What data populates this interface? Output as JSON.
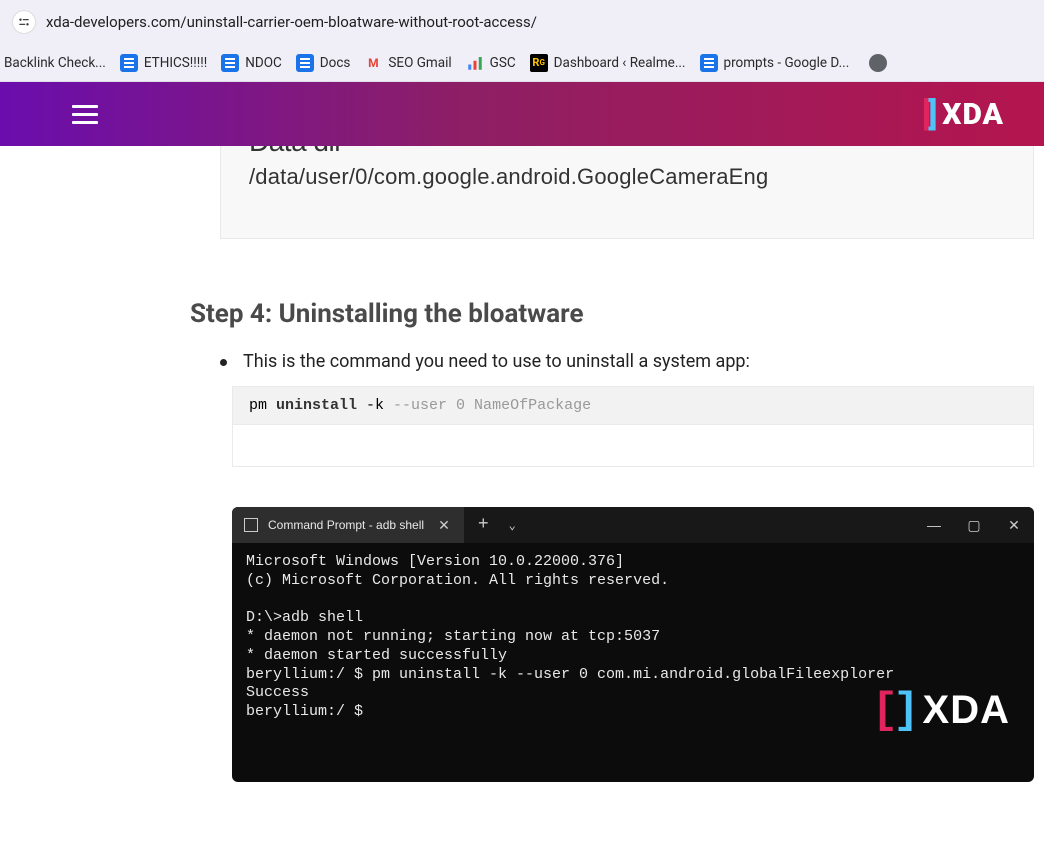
{
  "browser": {
    "url": "xda-developers.com/uninstall-carrier-oem-bloatware-without-root-access/"
  },
  "bookmarks": [
    {
      "label": "Backlink Check...",
      "icon": "none"
    },
    {
      "label": "ETHICS!!!!!",
      "icon": "docs"
    },
    {
      "label": "NDOC",
      "icon": "docs"
    },
    {
      "label": "Docs",
      "icon": "docs"
    },
    {
      "label": "SEO Gmail",
      "icon": "gmail"
    },
    {
      "label": "GSC",
      "icon": "gsc"
    },
    {
      "label": "Dashboard ‹ Realme...",
      "icon": "realme"
    },
    {
      "label": "prompts - Google D...",
      "icon": "docs"
    }
  ],
  "header": {
    "logo_text": "XDA"
  },
  "article": {
    "partial_box_top": "Data dir",
    "partial_box_path": "/data/user/0/com.google.android.GoogleCameraEng",
    "step_heading": "Step 4: Uninstalling the bloatware",
    "bullet_text": "This is the command you need to use to uninstall a system app:",
    "code": {
      "prefix": "pm ",
      "keyword": "uninstall",
      "rest_plain": " -k ",
      "rest_args": "--user 0 NameOfPackage"
    }
  },
  "terminal": {
    "tab_title": "Command Prompt - adb  shell",
    "lines": [
      "Microsoft Windows [Version 10.0.22000.376]",
      "(c) Microsoft Corporation. All rights reserved.",
      "",
      "D:\\>adb shell",
      "* daemon not running; starting now at tcp:5037",
      "* daemon started successfully",
      "beryllium:/ $ pm uninstall -k --user 0 com.mi.android.globalFileexplorer",
      "Success",
      "beryllium:/ $"
    ],
    "watermark": "XDA"
  }
}
